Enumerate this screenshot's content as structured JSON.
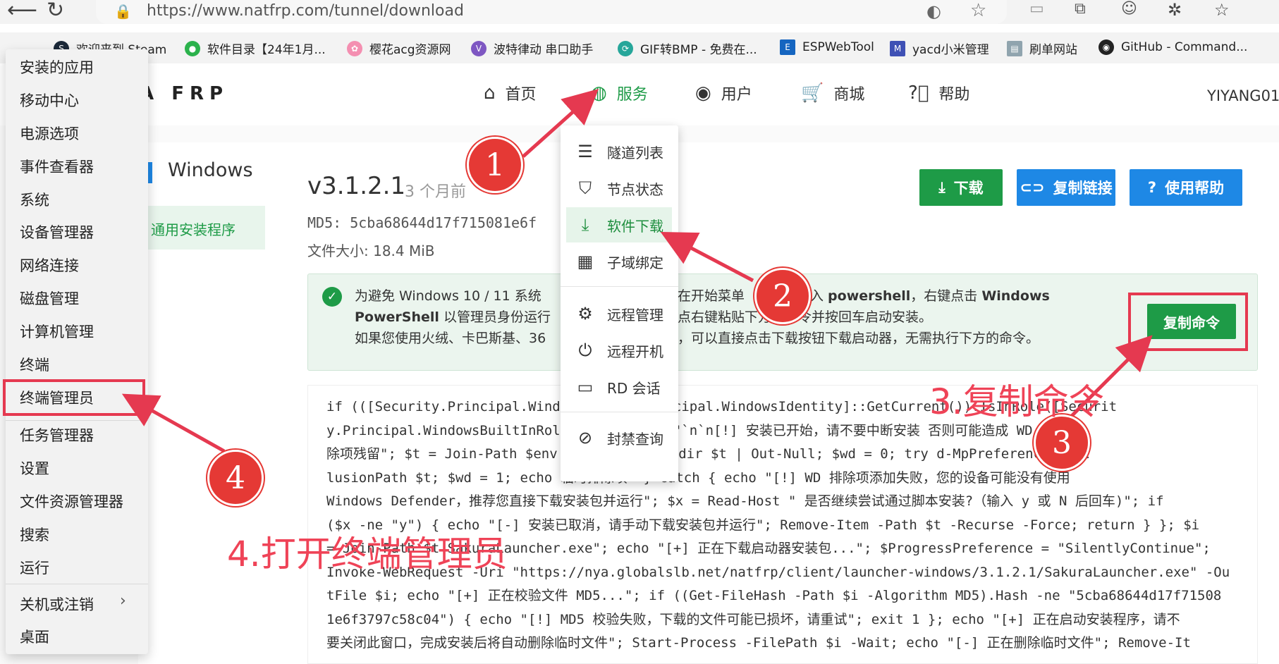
{
  "browser": {
    "url": "https://www.natfrp.com/tunnel/download",
    "bookmarks": [
      "欢迎来到 Steam",
      "软件目录【24年1月...",
      "樱花acg资源网",
      "波特律动 串口助手",
      "GIF转BMP - 免费在...",
      "ESPWebTool",
      "yacd小米管理",
      "刷单网站",
      "GitHub - Command..."
    ]
  },
  "site": {
    "logo": "RA FRP",
    "nav": [
      "首页",
      "服务",
      "用户",
      "商城",
      "帮助"
    ],
    "username": "YIYANG01",
    "sidebar": {
      "platform": "Windows",
      "active_item": "通用安装程序"
    },
    "version": "v3.1.2.1",
    "released": "3 个月前",
    "md5": "MD5: 5cba68644d17f715081e6f",
    "filesize": "文件大小: 18.4 MiB",
    "buttons": {
      "download": "下载",
      "copy_link": "复制链接",
      "help": "使用帮助",
      "copy_cmd": "复制命令"
    },
    "info": {
      "line1a": "为避免 Windows 10 / 11 系统",
      "line1b": "在开始菜单",
      "line1c": "入 ",
      "line1d": "powershell",
      "line1e": "，右键点击 ",
      "line1f": "Windows",
      "line2a": "PowerShell",
      "line2b": " 以管理员身份运行",
      "line2c": "点右键粘贴下方的命令并按回车启动安装。",
      "line3a": "如果您使用火绒、卡巴斯基、36",
      "line3b": "，可以直接点击下载按钮下载启动器，无需执行下方的命令。"
    },
    "code_lines": [
      "if (([Security.Principal.Wind                  Security.Principal.WindowsIdentity]::GetCurrent()).IsInRole([Securit",
      "y.Principal.WindowsBuiltInRol                 tor)) { echo \"`n`n[!] 安装已开始，请不要中断安装         否则可能造成 WD 排",
      "除项残留\"; $t = Join-Path $env                 (New-Guid); mkdir $t | Out-Null; $wd = 0; try        d-MpPreference -Exc",
      "lusionPath $t; $wd = 1; echo                  临时排除项\" } catch { echo \"[!] WD 排除项添加失败，您的设备可能没有使用",
      "Windows Defender，推荐您直接下载安装包并运行\"; $x = Read-Host \"  是否继续尝试通过脚本安装?（输入 y 或 N 后回车)\"; if",
      "($x -ne \"y\") { echo \"[-] 安装已取消，请手动下载安装包并运行\"; Remove-Item -Path $t -Recurse -Force; return } }; $i",
      "= Join-Path $t SakuraLauncher.exe\"; echo \"[+] 正在下载启动器安装包...\"; $ProgressPreference = \"SilentlyContinue\";",
      "Invoke-WebRequest -Uri \"https://nya.globalslb.net/natfrp/client/launcher-windows/3.1.2.1/SakuraLauncher.exe\" -Ou",
      "tFile $i; echo \"[+] 正在校验文件 MD5...\"; if ((Get-FileHash -Path $i -Algorithm MD5).Hash -ne \"5cba68644d17f71508",
      "1e6f3797c58c04\") { echo \"[!] MD5 校验失败，下载的文件可能已损坏，请重试\"; exit 1 }; echo \"[+] 正在启动安装程序，请不",
      "要关闭此窗口，完成安装后将自动删除临时文件\"; Start-Process -FilePath $i -Wait; echo \"[-] 正在删除临时文件\"; Remove-It"
    ]
  },
  "dropdown": [
    "隧道列表",
    "节点状态",
    "软件下载",
    "子域绑定",
    "远程管理",
    "远程开机",
    "RD 会话",
    "封禁查询"
  ],
  "start_menu": [
    "安装的应用",
    "移动中心",
    "电源选项",
    "事件查看器",
    "系统",
    "设备管理器",
    "网络连接",
    "磁盘管理",
    "计算机管理",
    "终端",
    "终端管理员",
    "任务管理器",
    "设置",
    "文件资源管理器",
    "搜索",
    "运行",
    "关机或注销",
    "桌面"
  ],
  "annotations": {
    "badges": [
      "1",
      "2",
      "3",
      "4"
    ],
    "step3": "3.复制命令",
    "step4": "4.打开终端管理员"
  },
  "colors": {
    "green": "#1e9b47",
    "blue": "#1e88e5",
    "red": "#e53950"
  },
  "icons": {
    "back": "arrow-left-icon",
    "refresh": "refresh-icon",
    "lock": "lock-icon"
  }
}
